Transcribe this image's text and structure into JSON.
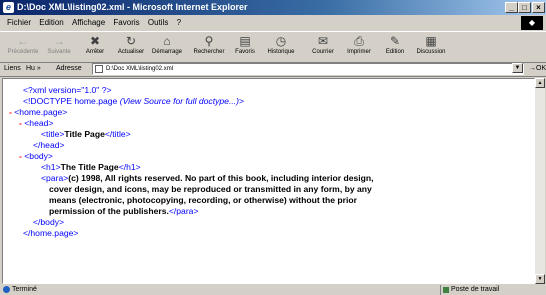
{
  "window": {
    "title": "D:\\Doc XML\\listing02.xml - Microsoft Internet Explorer",
    "ie_icon": "e",
    "controls": [
      "_",
      "□",
      "×"
    ],
    "logo": "◆"
  },
  "menu": [
    "Fichier",
    "Edition",
    "Affichage",
    "Favoris",
    "Outils",
    "?"
  ],
  "toolbar": [
    {
      "label": "Précédente",
      "icon": "arrow-left-icon",
      "glyph": "←",
      "enabled": false
    },
    {
      "label": "Suivante",
      "icon": "arrow-right-icon",
      "glyph": "→",
      "enabled": false
    },
    {
      "label": "Arrêter",
      "icon": "stop-icon",
      "glyph": "✖",
      "enabled": true
    },
    {
      "label": "Actualiser",
      "icon": "refresh-icon",
      "glyph": "↻",
      "enabled": true
    },
    {
      "label": "Démarrage",
      "icon": "home-icon",
      "glyph": "⌂",
      "enabled": true
    },
    {
      "label": "Rechercher",
      "icon": "search-icon",
      "glyph": "⚲",
      "enabled": true
    },
    {
      "label": "Favoris",
      "icon": "favorites-icon",
      "glyph": "▤",
      "enabled": true
    },
    {
      "label": "Historique",
      "icon": "history-icon",
      "glyph": "◷",
      "enabled": true
    },
    {
      "label": "Courrier",
      "icon": "mail-icon",
      "glyph": "✉",
      "enabled": true
    },
    {
      "label": "Imprimer",
      "icon": "print-icon",
      "glyph": "⎙",
      "enabled": true
    },
    {
      "label": "Edition",
      "icon": "edit-icon",
      "glyph": "✎",
      "enabled": true
    },
    {
      "label": "Discussion",
      "icon": "discussion-icon",
      "glyph": "▦",
      "enabled": true
    }
  ],
  "addressbar": {
    "liens": "Liens",
    "hu": "Hu »",
    "adresse": "Adresse",
    "url": "D:\\Doc XML\\listing02.xml",
    "go": "OK"
  },
  "xml": {
    "decl": "<?xml version=\"1.0\" ?>",
    "doctype_start": "<!DOCTYPE home.page ",
    "doctype_link": "(View Source for full doctype...)",
    "doctype_end": ">",
    "home_open": "<home.page>",
    "head_open": "<head>",
    "title_open": "<title>",
    "title_text": "Title Page",
    "title_close": "</title>",
    "head_close": "</head>",
    "body_open": "<body>",
    "h1_open": "<h1>",
    "h1_text": "The Title Page",
    "h1_close": "</h1>",
    "para_open": "<para>",
    "para_line1": "(c) 1998, All rights reserved. No part of this book, including interior design,",
    "para_line2": "cover design, and icons, may be reproduced or transmitted in any form, by any",
    "para_line3": "means (electronic, photocopying, recording, or otherwise) without the prior",
    "para_line4": "permission of the publishers.",
    "para_close": "</para>",
    "body_close": "</body>",
    "home_close": "</home.page>",
    "minus": "-"
  },
  "status": {
    "text": "Terminé",
    "zone": "Poste de travail"
  }
}
